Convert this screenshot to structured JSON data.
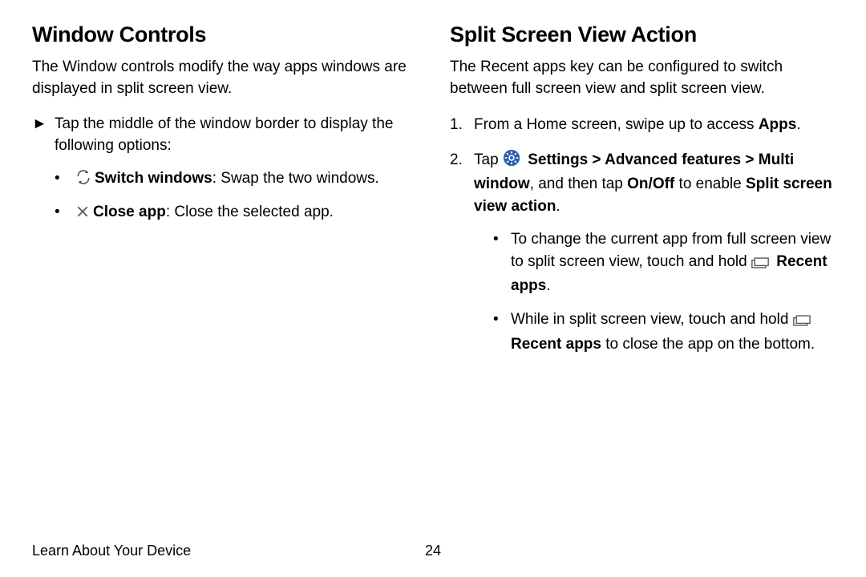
{
  "left": {
    "heading": "Window Controls",
    "intro": "The Window controls modify the way apps windows are displayed in split screen view.",
    "instruction": "Tap the middle of the window border to display the following options:",
    "switch_label": "Switch windows",
    "switch_desc": ": Swap the two windows.",
    "close_label": "Close app",
    "close_desc": ": Close the selected app."
  },
  "right": {
    "heading": "Split Screen View Action",
    "intro": "The Recent apps key can be configured to switch between full screen view and split screen view.",
    "step1_a": "From a Home screen, swipe up to access ",
    "step1_b": "Apps",
    "step1_c": ".",
    "s2_tap": "Tap ",
    "s2_settings": " Settings",
    "s2_af": " Advanced features",
    "s2_mw": "Multi window",
    "s2_mid": ", and then tap ",
    "s2_onoff": "On/Off",
    "s2_enable": " to enable ",
    "s2_ssva": "Split screen view action",
    "s2_dot": ".",
    "sub1_a": "To change the current app from full screen view to split screen view, touch and hold ",
    "sub1_b": "Recent apps",
    "sub1_c": ".",
    "sub2_a": "While in split screen view, touch and hold ",
    "sub2_b": "Recent apps",
    "sub2_c": " to close the app on the bottom."
  },
  "footer": {
    "section": "Learn About Your Device",
    "page": "24"
  },
  "glyphs": {
    "arrow": "►",
    "chev": " > "
  }
}
